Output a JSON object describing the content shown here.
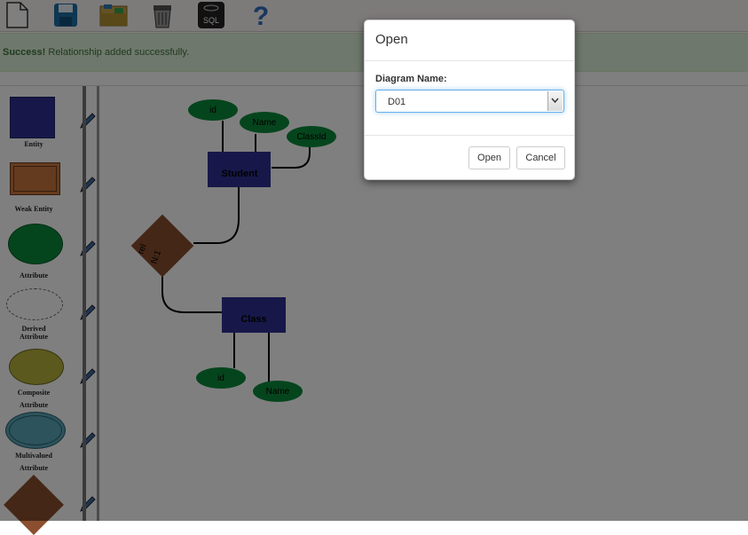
{
  "toolbar": {
    "icons": [
      "new-file-icon",
      "save-icon",
      "open-folder-icon",
      "delete-bin-icon",
      "sql-icon",
      "help-icon"
    ],
    "sql_label": "SQL",
    "help_label": "?"
  },
  "alert": {
    "strong": "Success!",
    "message": " Relationship added successfully."
  },
  "palette": {
    "items": [
      {
        "label": "Entity"
      },
      {
        "label": "Weak Entity"
      },
      {
        "label": "Attribute"
      },
      {
        "label_lines": [
          "Derived",
          "Attribute"
        ]
      },
      {
        "label_lines": [
          "Composite",
          "Attribute"
        ]
      },
      {
        "label_lines": [
          "Multivalued",
          "Attribute"
        ]
      }
    ]
  },
  "diagram": {
    "entities": [
      {
        "name": "Student"
      },
      {
        "name": "Class"
      }
    ],
    "attributes": [
      "id",
      "Name",
      "ClassId",
      "id",
      "Name"
    ],
    "relationship": {
      "name": "rel",
      "cardinality": "N:1"
    }
  },
  "modal": {
    "title": "Open",
    "field_label": "Diagram Name:",
    "selected": "D01",
    "open_label": "Open",
    "cancel_label": "Cancel"
  },
  "colors": {
    "entity": "#2e3192",
    "weak_entity": "#c8773f",
    "attribute": "#0a8a3a",
    "relationship": "#8b4f2f",
    "composite": "#b8b33c",
    "multivalued": "#5aa7b8",
    "success_bg": "#dff0d8",
    "success_text": "#3c763d"
  }
}
